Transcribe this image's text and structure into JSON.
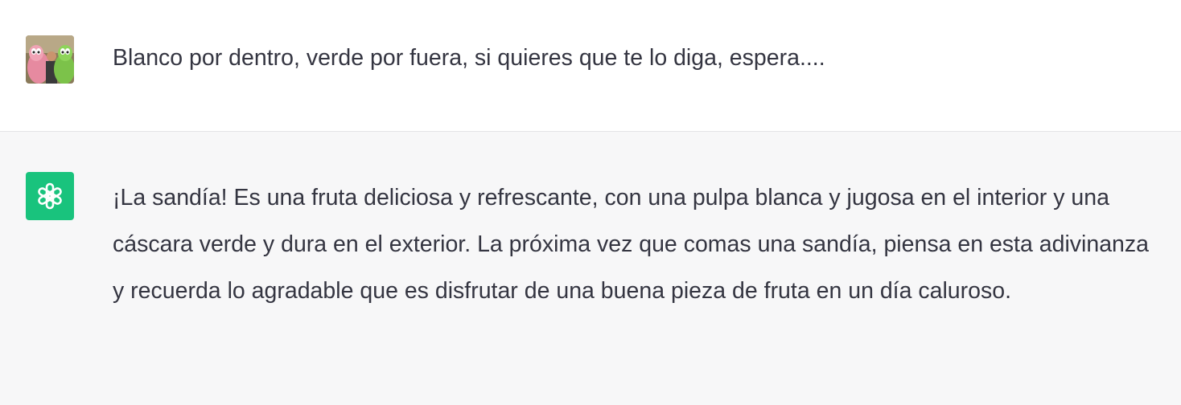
{
  "conversation": {
    "user_message": {
      "avatar": "user-photo-avatar",
      "text": "Blanco por dentro, verde por fuera, si quieres que te lo diga, espera...."
    },
    "assistant_message": {
      "avatar": "openai-logo-icon",
      "avatar_color": "#19c37d",
      "text": "¡La sandía! Es una fruta deliciosa y refrescante, con una pulpa blanca y jugosa en el interior y una cáscara verde y dura en el exterior. La próxima vez que comas una sandía, piensa en esta adivinanza y recuerda lo agradable que es disfrutar de una buena pieza de fruta en un día caluroso."
    }
  },
  "colors": {
    "user_row_bg": "#ffffff",
    "assistant_row_bg": "#f7f7f8",
    "text": "#343541",
    "divider": "#e3e3e6"
  }
}
